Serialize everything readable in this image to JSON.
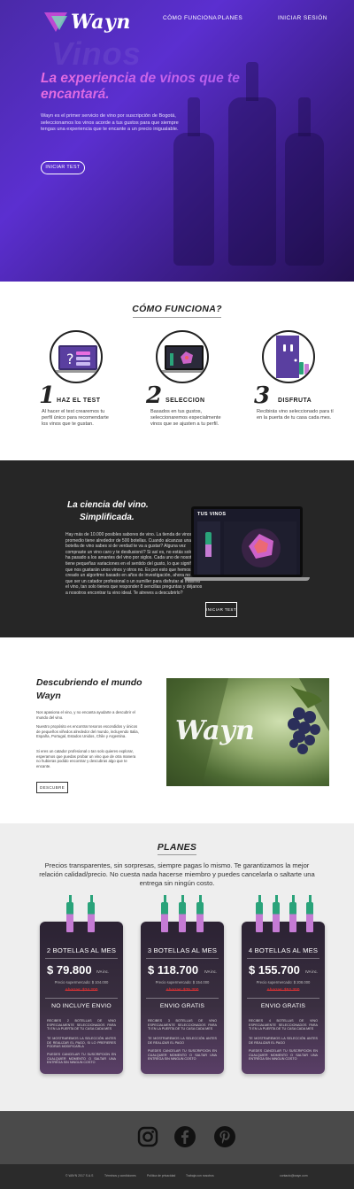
{
  "brand": {
    "name": "Wayn",
    "watermark": "Vinos",
    "photo_logo": "Wayn"
  },
  "nav": {
    "como": "CÓMO FUNCIONA",
    "planes": "PLANES",
    "login": "INICIAR SESIÓN"
  },
  "hero": {
    "title": "La experiencia de vinos que te encantará.",
    "text": "Wayn es el primer servicio de vino por suscripción de Bogotá, seleccionamos los vinos acorde a tus gustos para que siempre tengas una experiencia que te encante a un precio inigualable.",
    "cta": "INICIAR TEST"
  },
  "como": {
    "title": "CÓMO FUNCIONA?",
    "steps": [
      {
        "num": "1",
        "title": "HAZ EL TEST",
        "text": "Al hacer el test crearemos tu perfil único para recomendarte los vinos que te gustan."
      },
      {
        "num": "2",
        "title": "SELECCION",
        "text": "Basados en tus gustos, seleccionaremos especialmente vinos que se ajusten a tu perfil."
      },
      {
        "num": "3",
        "title": "DISFRUTA",
        "text": "Recibirás vino seleccionado para tí en la puerta de tu casa cada mes."
      }
    ]
  },
  "ciencia": {
    "title_1": "La ciencia del vino.",
    "title_2": "Simplificada.",
    "text": "Hay más de 10.000 posibles sabores de vino. La tienda de vinos promedio tiene alrededor de 500 botellas. Cuando alcanzas una botella de vino sabes si de verdad te va a gustar? Alguna vez compraste un vino caro y te desilusionó? Si así es, no estás solo/a, le ha pasado a los amantes del vino por siglos. Cada uno de nosotros tiene pequeñas variaciones en el sentido del gusto, lo que significa que nos gustarán unos vinos y otros no. Es por esto que hemos creado un algoritmo basado en años de investigación, ahora no tienes que ser un catador profesional o un sumiller para disfrutar al máximo el vino, tan solo tienes que responder 8 sencillas preguntas y déjanos a nosotros encontrar tu vino ideal. Te atreves a descubrirlo?",
    "screen_title": "TUS VINOS",
    "cta": "INICIAR TEST"
  },
  "descubriendo": {
    "title_1": "Descubriendo el mundo",
    "title_2": "Wayn",
    "p1": "Nos apasiona el vino, y no encanta ayudarte a descubrir el mundo del vino.",
    "p2": "Nuestro propósito es encontrar tesoros escondidos y únicos de pequeños viñedos alrededor del mundo, incluyendo Italia, España, Portugal, Estados Unidos, Chile y Argentina.",
    "p3": "Si eres un catador profesional o tan solo quieres explorar, esperamos que puedas probar un vino que de otra manera no hubieras podido encontrar y descubras algo que te encante.",
    "cta": "DESCUBRE"
  },
  "planes": {
    "title": "PLANES",
    "intro": "Precios transparentes, sin sorpresas, siempre pagas lo mismo. Te garantizamos la mejor relación calidad/precio. No cuesta nada hacerse miembro y puedes cancelarla o saltarte una entrega sin ningún costo.",
    "cards": [
      {
        "name": "2 BOTELLAS AL MES",
        "price": "$ 79.800",
        "iva": "IVA inc.",
        "super": "Precio supermercado: $ 104.000",
        "ahorro": "Ahorras: $24.200",
        "envio": "NO INCLUYE ENVIO",
        "f1": "RECIBES 2 BOTELLAS DE VINO ESPECIALMENTE SELECCIONADOS PARA TI EN LA PUERTA DE TU CASA CADA MES",
        "f2": "TE MOSTRAREMOS LA SELECCIÓN ANTES DE REALIZAR EL PAGO, SI LO PREFIERES PODRAS MODIFICARLA",
        "f3": "PUEDES CANCELAR TU SUSCRIPCION EN CUALQUIER MOMENTO O SALTAR UNA ENTREGA SIN NINGUN COSTO"
      },
      {
        "name": "3 BOTELLAS AL MES",
        "price": "$ 118.700",
        "iva": "IVA inc.",
        "super": "Precio supermercado: $ 154.000",
        "ahorro": "Ahorras: $35.300",
        "envio": "ENVIO GRATIS",
        "f1": "RECIBES 3 BOTELLAS DE VINO ESPECIALMENTE SELECCIONADOS PARA TI EN LA PUERTA DE TU CASA CADA MES",
        "f2": "TE MOSTRAREMOS LA SELECCIÓN ANTES DE REALIZAR EL PAGO",
        "f3": "PUEDES CANCELAR TU SUSCRIPCION EN CUALQUIER MOMENTO O SALTAR UNA ENTREGA SIN NINGUN COSTO"
      },
      {
        "name": "4 BOTELLAS AL MES",
        "price": "$ 155.700",
        "iva": "IVA inc.",
        "super": "Precio supermercado: $ 208.000",
        "ahorro": "Ahorras: $52.300",
        "envio": "ENVIO GRATIS",
        "f1": "RECIBES 4 BOTELLAS DE VINO ESPECIALMENTE SELECCIONADOS PARA TI EN LA PUERTA DE TU CASA CADA MES",
        "f2": "TE MOSTRAREMOS LA SELECCIÓN ANTES DE REALIZAR EL PAGO",
        "f3": "PUEDES CANCELAR TU SUSCRIPCION EN CUALQUIER MOMENTO O SALTAR UNA ENTREGA SIN NINGUN COSTO"
      }
    ]
  },
  "footer": {
    "social": [
      "instagram-icon",
      "facebook-icon",
      "pinterest-icon"
    ],
    "links": [
      "© WAYN 2017 S.A.S",
      "Términos y condiciones",
      "Política de privacidad",
      "Trabaja con nosotros",
      "contacto@wayn.com"
    ]
  },
  "colors": {
    "hero_start": "#4a2aa8",
    "hero_end": "#241052",
    "accent_pink": "#e86de0",
    "accent_green": "#2aa37a",
    "dark_bg": "#262626",
    "plans_bg": "#eeeeee"
  }
}
